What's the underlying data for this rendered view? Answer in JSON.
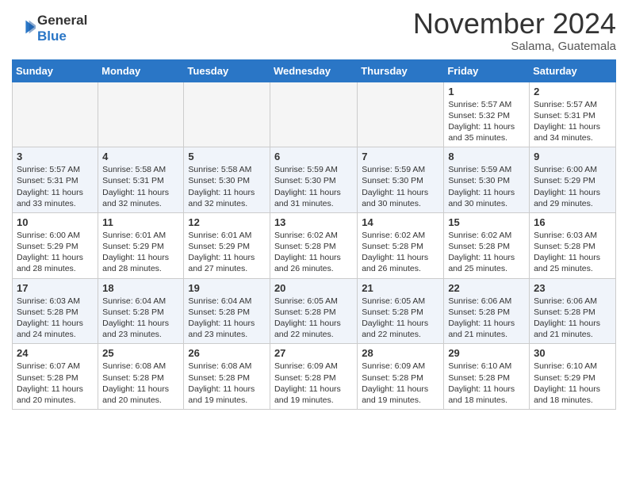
{
  "header": {
    "logo_line1": "General",
    "logo_line2": "Blue",
    "month": "November 2024",
    "location": "Salama, Guatemala"
  },
  "weekdays": [
    "Sunday",
    "Monday",
    "Tuesday",
    "Wednesday",
    "Thursday",
    "Friday",
    "Saturday"
  ],
  "weeks": [
    [
      {
        "day": "",
        "info": ""
      },
      {
        "day": "",
        "info": ""
      },
      {
        "day": "",
        "info": ""
      },
      {
        "day": "",
        "info": ""
      },
      {
        "day": "",
        "info": ""
      },
      {
        "day": "1",
        "info": "Sunrise: 5:57 AM\nSunset: 5:32 PM\nDaylight: 11 hours\nand 35 minutes."
      },
      {
        "day": "2",
        "info": "Sunrise: 5:57 AM\nSunset: 5:31 PM\nDaylight: 11 hours\nand 34 minutes."
      }
    ],
    [
      {
        "day": "3",
        "info": "Sunrise: 5:57 AM\nSunset: 5:31 PM\nDaylight: 11 hours\nand 33 minutes."
      },
      {
        "day": "4",
        "info": "Sunrise: 5:58 AM\nSunset: 5:31 PM\nDaylight: 11 hours\nand 32 minutes."
      },
      {
        "day": "5",
        "info": "Sunrise: 5:58 AM\nSunset: 5:30 PM\nDaylight: 11 hours\nand 32 minutes."
      },
      {
        "day": "6",
        "info": "Sunrise: 5:59 AM\nSunset: 5:30 PM\nDaylight: 11 hours\nand 31 minutes."
      },
      {
        "day": "7",
        "info": "Sunrise: 5:59 AM\nSunset: 5:30 PM\nDaylight: 11 hours\nand 30 minutes."
      },
      {
        "day": "8",
        "info": "Sunrise: 5:59 AM\nSunset: 5:30 PM\nDaylight: 11 hours\nand 30 minutes."
      },
      {
        "day": "9",
        "info": "Sunrise: 6:00 AM\nSunset: 5:29 PM\nDaylight: 11 hours\nand 29 minutes."
      }
    ],
    [
      {
        "day": "10",
        "info": "Sunrise: 6:00 AM\nSunset: 5:29 PM\nDaylight: 11 hours\nand 28 minutes."
      },
      {
        "day": "11",
        "info": "Sunrise: 6:01 AM\nSunset: 5:29 PM\nDaylight: 11 hours\nand 28 minutes."
      },
      {
        "day": "12",
        "info": "Sunrise: 6:01 AM\nSunset: 5:29 PM\nDaylight: 11 hours\nand 27 minutes."
      },
      {
        "day": "13",
        "info": "Sunrise: 6:02 AM\nSunset: 5:28 PM\nDaylight: 11 hours\nand 26 minutes."
      },
      {
        "day": "14",
        "info": "Sunrise: 6:02 AM\nSunset: 5:28 PM\nDaylight: 11 hours\nand 26 minutes."
      },
      {
        "day": "15",
        "info": "Sunrise: 6:02 AM\nSunset: 5:28 PM\nDaylight: 11 hours\nand 25 minutes."
      },
      {
        "day": "16",
        "info": "Sunrise: 6:03 AM\nSunset: 5:28 PM\nDaylight: 11 hours\nand 25 minutes."
      }
    ],
    [
      {
        "day": "17",
        "info": "Sunrise: 6:03 AM\nSunset: 5:28 PM\nDaylight: 11 hours\nand 24 minutes."
      },
      {
        "day": "18",
        "info": "Sunrise: 6:04 AM\nSunset: 5:28 PM\nDaylight: 11 hours\nand 23 minutes."
      },
      {
        "day": "19",
        "info": "Sunrise: 6:04 AM\nSunset: 5:28 PM\nDaylight: 11 hours\nand 23 minutes."
      },
      {
        "day": "20",
        "info": "Sunrise: 6:05 AM\nSunset: 5:28 PM\nDaylight: 11 hours\nand 22 minutes."
      },
      {
        "day": "21",
        "info": "Sunrise: 6:05 AM\nSunset: 5:28 PM\nDaylight: 11 hours\nand 22 minutes."
      },
      {
        "day": "22",
        "info": "Sunrise: 6:06 AM\nSunset: 5:28 PM\nDaylight: 11 hours\nand 21 minutes."
      },
      {
        "day": "23",
        "info": "Sunrise: 6:06 AM\nSunset: 5:28 PM\nDaylight: 11 hours\nand 21 minutes."
      }
    ],
    [
      {
        "day": "24",
        "info": "Sunrise: 6:07 AM\nSunset: 5:28 PM\nDaylight: 11 hours\nand 20 minutes."
      },
      {
        "day": "25",
        "info": "Sunrise: 6:08 AM\nSunset: 5:28 PM\nDaylight: 11 hours\nand 20 minutes."
      },
      {
        "day": "26",
        "info": "Sunrise: 6:08 AM\nSunset: 5:28 PM\nDaylight: 11 hours\nand 19 minutes."
      },
      {
        "day": "27",
        "info": "Sunrise: 6:09 AM\nSunset: 5:28 PM\nDaylight: 11 hours\nand 19 minutes."
      },
      {
        "day": "28",
        "info": "Sunrise: 6:09 AM\nSunset: 5:28 PM\nDaylight: 11 hours\nand 19 minutes."
      },
      {
        "day": "29",
        "info": "Sunrise: 6:10 AM\nSunset: 5:28 PM\nDaylight: 11 hours\nand 18 minutes."
      },
      {
        "day": "30",
        "info": "Sunrise: 6:10 AM\nSunset: 5:29 PM\nDaylight: 11 hours\nand 18 minutes."
      }
    ]
  ]
}
